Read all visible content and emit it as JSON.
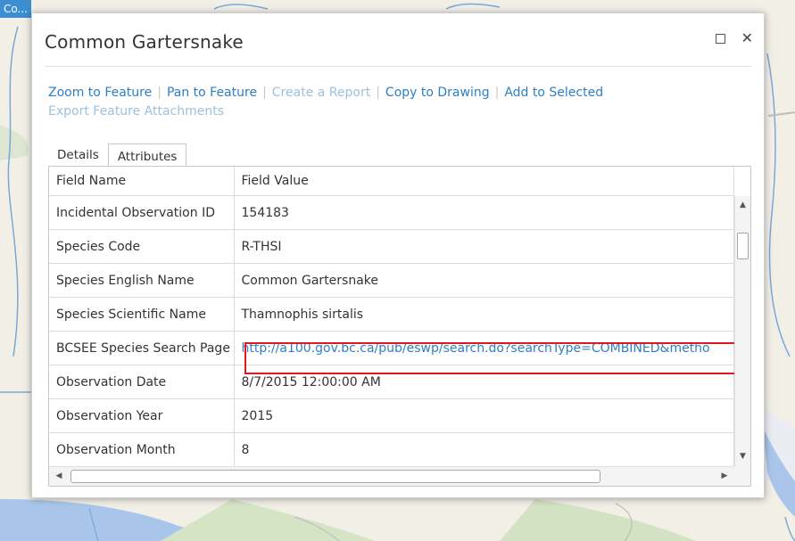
{
  "map": {
    "tab_label": "Co..."
  },
  "popup": {
    "title": "Common Gartersnake",
    "actions": [
      {
        "label": "Zoom to Feature",
        "enabled": true
      },
      {
        "label": "Pan to Feature",
        "enabled": true
      },
      {
        "label": "Create a Report",
        "enabled": false
      },
      {
        "label": "Copy to Drawing",
        "enabled": true
      },
      {
        "label": "Add to Selected",
        "enabled": true
      },
      {
        "label": "Export Feature Attachments",
        "enabled": false
      }
    ],
    "tabs": [
      {
        "label": "Details",
        "active": false
      },
      {
        "label": "Attributes",
        "active": true
      }
    ],
    "table": {
      "headers": [
        "Field Name",
        "Field Value"
      ],
      "rows": [
        {
          "name": "Incidental Observation ID",
          "value": "154183"
        },
        {
          "name": "Species Code",
          "value": "R-THSI"
        },
        {
          "name": "Species English Name",
          "value": "Common Gartersnake"
        },
        {
          "name": "Species Scientific Name",
          "value": "Thamnophis sirtalis"
        },
        {
          "name": "BCSEE Species Search Page",
          "value": "http://a100.gov.bc.ca/pub/eswp/search.do?searchType=COMBINED&metho"
        },
        {
          "name": "Observation Date",
          "value": "8/7/2015 12:00:00 AM"
        },
        {
          "name": "Observation Year",
          "value": "2015"
        },
        {
          "name": "Observation Month",
          "value": "8"
        }
      ]
    }
  },
  "colors": {
    "link": "#2f7fc1",
    "highlight": "#e0191e",
    "map_tab": "#3c8ed0"
  }
}
